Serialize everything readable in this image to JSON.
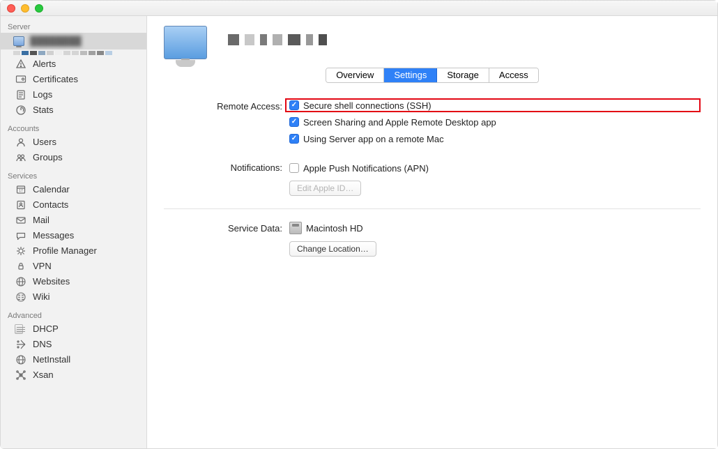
{
  "sidebar": {
    "sections": {
      "server": "Server",
      "accounts": "Accounts",
      "services": "Services",
      "advanced": "Advanced"
    },
    "items": {
      "alerts": "Alerts",
      "certificates": "Certificates",
      "logs": "Logs",
      "stats": "Stats",
      "users": "Users",
      "groups": "Groups",
      "calendar": "Calendar",
      "contacts": "Contacts",
      "mail": "Mail",
      "messages": "Messages",
      "profile_manager": "Profile Manager",
      "vpn": "VPN",
      "websites": "Websites",
      "wiki": "Wiki",
      "dhcp": "DHCP",
      "dns": "DNS",
      "netinstall": "NetInstall",
      "xsan": "Xsan"
    }
  },
  "tabs": {
    "overview": "Overview",
    "settings": "Settings",
    "storage": "Storage",
    "access": "Access",
    "active": "settings"
  },
  "form": {
    "remote_access_label": "Remote Access:",
    "ssh": "Secure shell connections (SSH)",
    "screen_sharing": "Screen Sharing and Apple Remote Desktop app",
    "remote_server_app": "Using Server app on a remote Mac",
    "notifications_label": "Notifications:",
    "apn": "Apple Push Notifications (APN)",
    "edit_apple_id": "Edit Apple ID…",
    "service_data_label": "Service Data:",
    "disk_name": "Macintosh HD",
    "change_location": "Change Location…"
  }
}
